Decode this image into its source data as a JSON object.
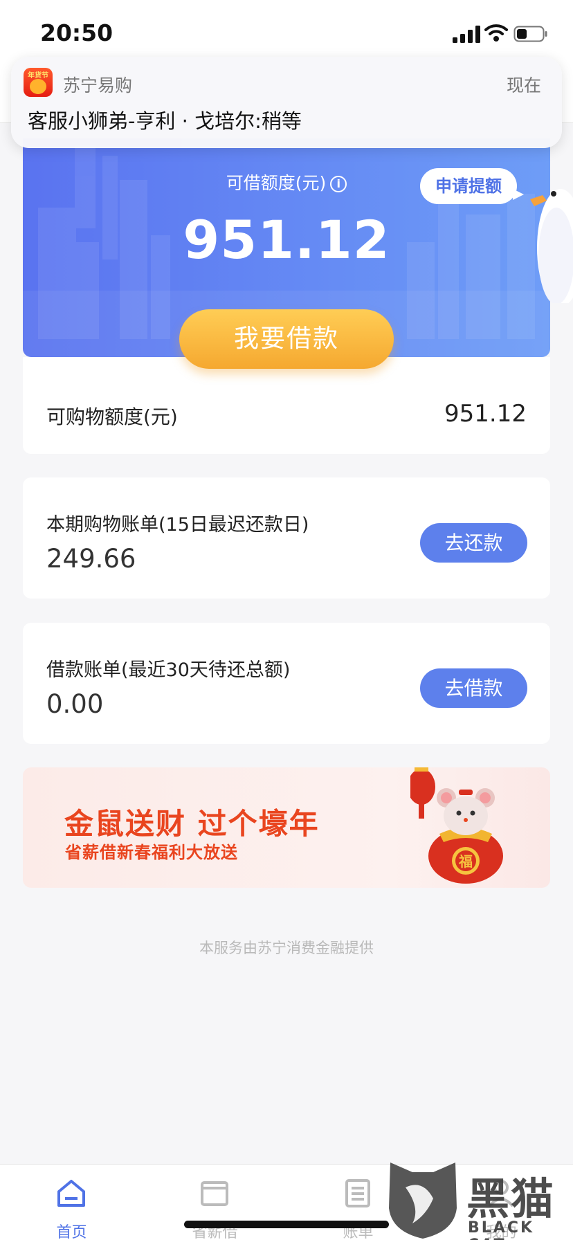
{
  "status_bar": {
    "time": "20:50"
  },
  "notification": {
    "icon_label": "年货节",
    "app_name": "苏宁易购",
    "time": "现在",
    "message": "客服小狮弟-亨利 · 戈培尔:稍等"
  },
  "credit": {
    "label": "可借额度(元)",
    "info_glyph": "i",
    "amount": "951.12",
    "apply_bubble": "申请提额",
    "borrow_button": "我要借款"
  },
  "shopping_credit": {
    "label": "可购物额度(元)",
    "value": "951.12"
  },
  "bills": [
    {
      "title": "本期购物账单(15日最迟还款日)",
      "amount": "249.66",
      "button": "去还款"
    },
    {
      "title": "借款账单(最近30天待还总额)",
      "amount": "0.00",
      "button": "去借款"
    }
  ],
  "promo": {
    "title": "金鼠送财 过个壕年",
    "subtitle": "省薪借新春福利大放送",
    "bag_char": "福"
  },
  "footer_note": "本服务由苏宁消费金融提供",
  "tabs": [
    {
      "label": "首页",
      "icon": "home-icon",
      "active": true
    },
    {
      "label": "省薪借",
      "icon": "wallet-icon",
      "active": false
    },
    {
      "label": "账单",
      "icon": "document-icon",
      "active": false
    },
    {
      "label": "我的",
      "icon": "user-icon",
      "active": false
    }
  ],
  "watermark": {
    "text": "黑猫",
    "subtitle": "BLACK CAT"
  },
  "colors": {
    "primary": "#5d80ec",
    "accent": "#f5a830",
    "promo_red": "#e9451f"
  }
}
